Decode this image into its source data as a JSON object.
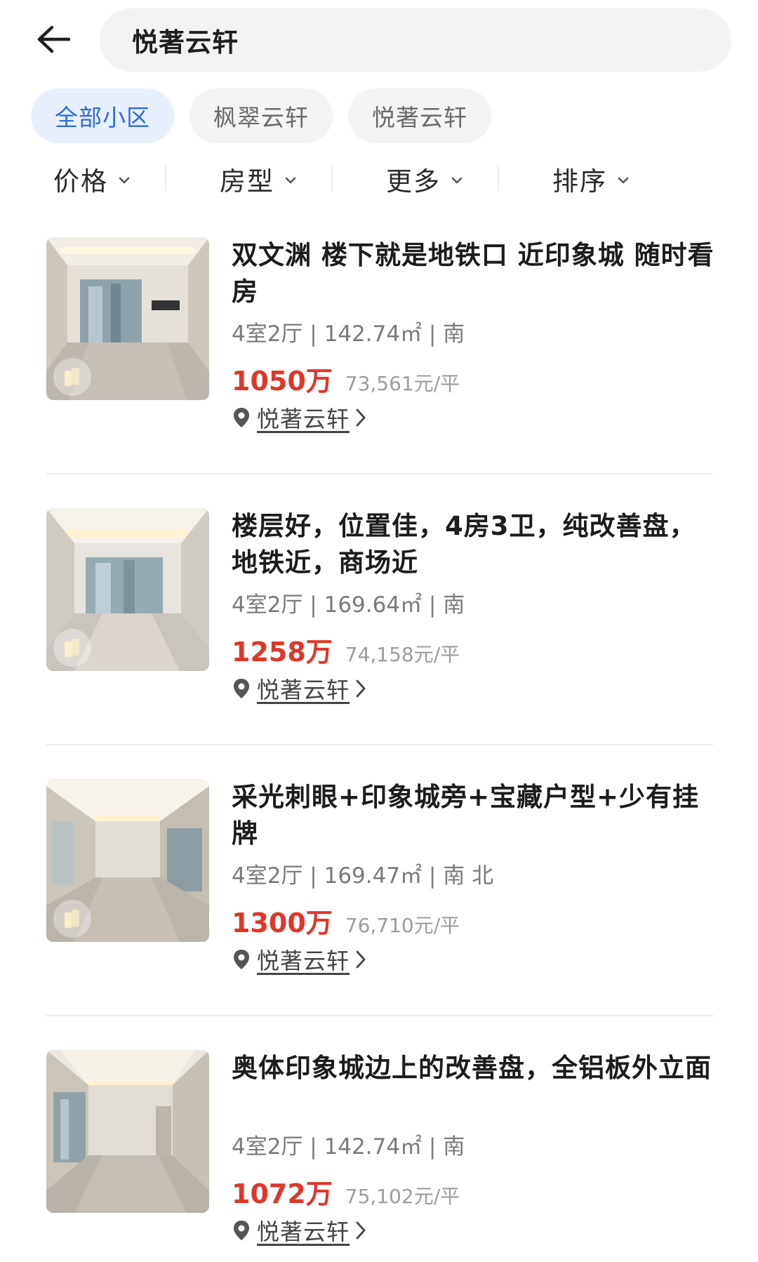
{
  "search": {
    "query": "悦著云轩"
  },
  "chips": [
    {
      "label": "全部小区",
      "active": true
    },
    {
      "label": "枫翠云轩",
      "active": false
    },
    {
      "label": "悦著云轩",
      "active": false
    }
  ],
  "filters": [
    {
      "label": "价格"
    },
    {
      "label": "房型"
    },
    {
      "label": "更多"
    },
    {
      "label": "排序"
    }
  ],
  "listings": [
    {
      "title": "双文渊 楼下就是地铁口 近印象城 随时看房",
      "specs": "4室2厅 | 142.74㎡ | 南",
      "price": "1050万",
      "unit_price": "73,561元/平",
      "community": "悦著云轩"
    },
    {
      "title": "楼层好，位置佳，4房3卫，纯改善盘，地铁近，商场近",
      "specs": "4室2厅 | 169.64㎡ | 南",
      "price": "1258万",
      "unit_price": "74,158元/平",
      "community": "悦著云轩"
    },
    {
      "title": "采光刺眼+印象城旁+宝藏户型+少有挂牌",
      "specs": "4室2厅 | 169.47㎡ | 南 北",
      "price": "1300万",
      "unit_price": "76,710元/平",
      "community": "悦著云轩"
    },
    {
      "title": "奥体印象城边上的改善盘，全铝板外立面",
      "specs": "4室2厅 | 142.74㎡ | 南",
      "price": "1072万",
      "unit_price": "75,102元/平",
      "community": "悦著云轩"
    }
  ],
  "colors": {
    "accent": "#2d6be0",
    "accent_bg": "#e8f0fd",
    "price": "#e0362a",
    "muted": "#7a7a7a"
  },
  "icons": {
    "back": "arrow-left-icon",
    "caret": "caret-down-icon",
    "pin": "location-pin-icon",
    "chevron": "chevron-right-icon",
    "vr": "vr-tour-icon"
  }
}
